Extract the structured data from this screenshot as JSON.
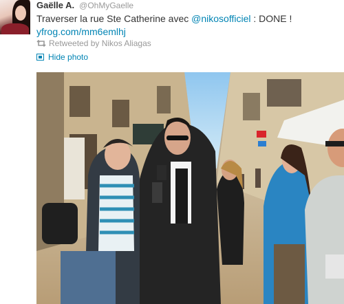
{
  "author": {
    "display_name": "Gaëlle A.",
    "screen_name": "@OhMyGaelle"
  },
  "tweet": {
    "text_before": "Traverser la rue Ste Catherine avec ",
    "mention": "@nikosofficiel",
    "text_after": " : DONE !",
    "link": "yfrog.com/mm6emlhj"
  },
  "retweet": {
    "label": "Retweeted by Nikos Aliagas",
    "icon": "retweet-icon"
  },
  "media": {
    "hide_label": "Hide photo",
    "icon": "photo-icon"
  },
  "colors": {
    "link": "#0084b4",
    "text": "#333333",
    "muted": "#999999"
  }
}
